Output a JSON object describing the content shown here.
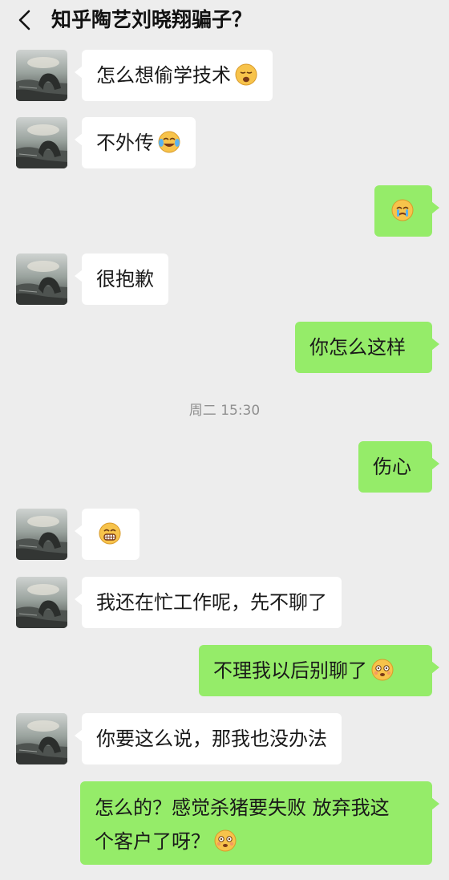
{
  "header": {
    "title": "知乎陶艺刘晓翔骗子？"
  },
  "messages": [
    {
      "side": "in",
      "text": "怎么想偷学技术",
      "emoji": "sleepy-face"
    },
    {
      "side": "in",
      "text": "不外传",
      "emoji": "tears-of-joy-face"
    },
    {
      "side": "out",
      "text": "",
      "emoji": "crying-face"
    },
    {
      "side": "in",
      "text": "很抱歉",
      "emoji": ""
    },
    {
      "side": "out",
      "text": "你怎么这样",
      "emoji": ""
    },
    {
      "side": "out",
      "text": "伤心",
      "emoji": ""
    },
    {
      "side": "in",
      "text": "",
      "emoji": "grinning-face"
    },
    {
      "side": "in",
      "text": "我还在忙工作呢，先不聊了",
      "emoji": ""
    },
    {
      "side": "out",
      "text": "不理我以后别聊了",
      "emoji": "dizzy-face"
    },
    {
      "side": "in",
      "text": "你要这么说，那我也没办法",
      "emoji": ""
    },
    {
      "side": "out",
      "line1": "怎么的？感觉杀猪要失败 放弃我这",
      "line2": "个客户了呀？",
      "emoji": "dizzy-face"
    }
  ],
  "timestamp": "周二 15:30",
  "colors": {
    "background": "#ededed",
    "incoming_bubble": "#ffffff",
    "outgoing_bubble": "#95ec69"
  }
}
